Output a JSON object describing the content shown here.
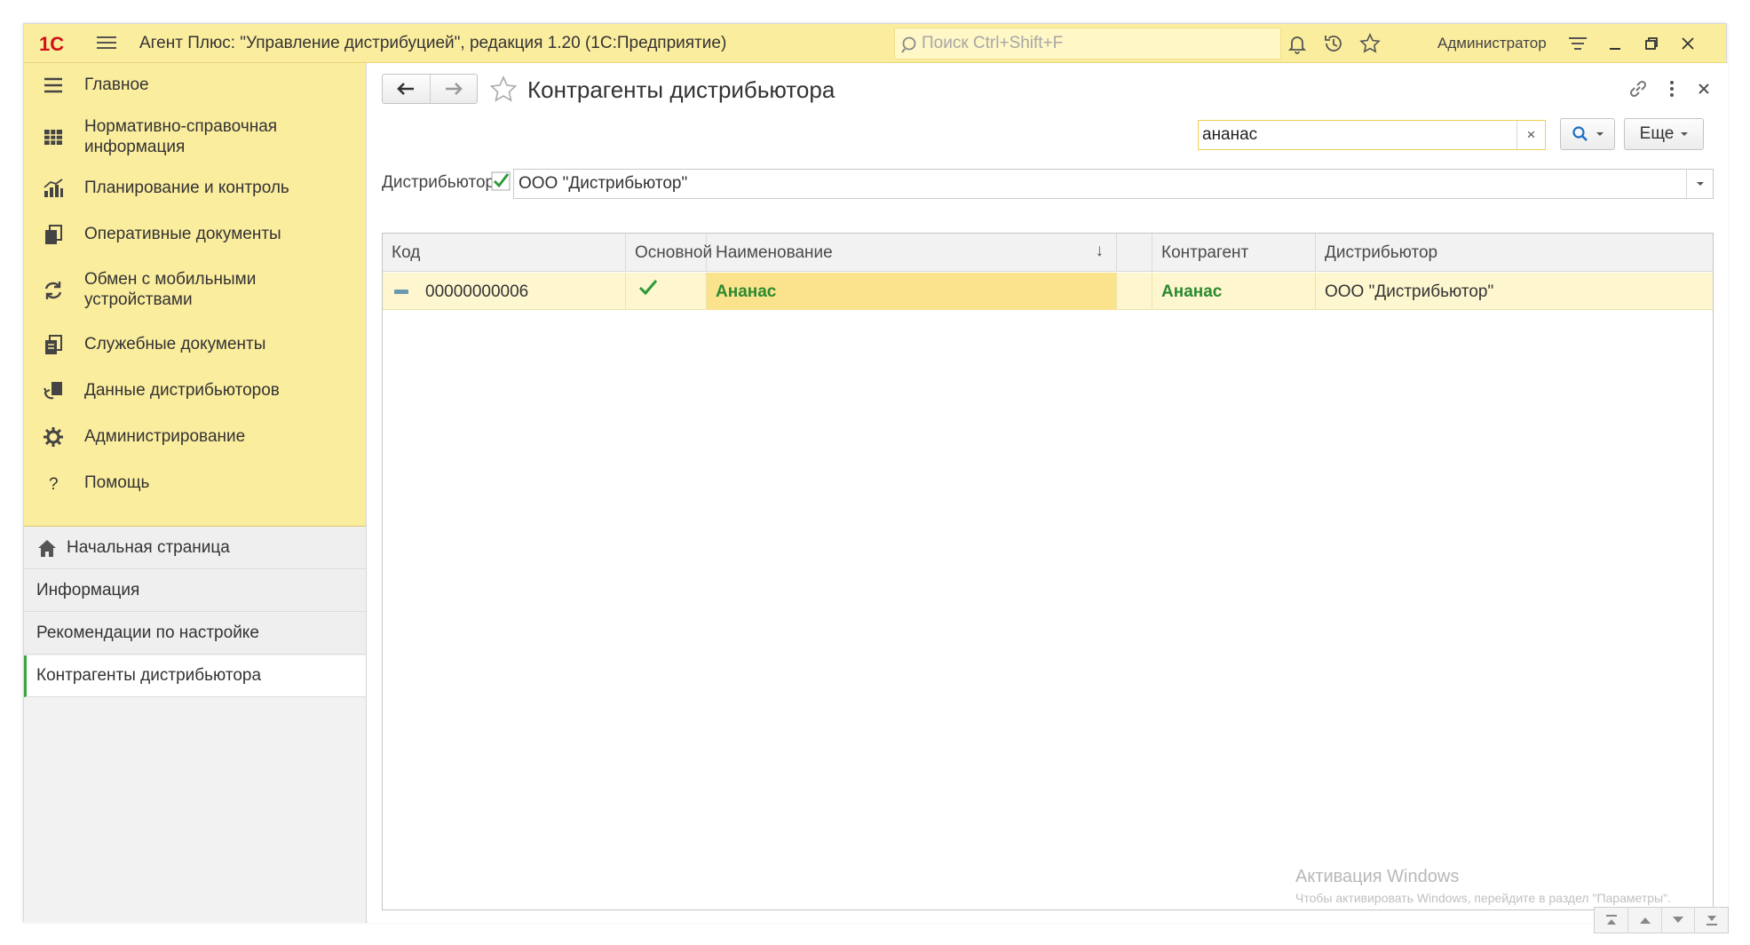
{
  "titlebar": {
    "logo_text": "1С",
    "app_title": "Агент Плюс: \"Управление дистрибуцией\", редакция 1.20  (1С:Предприятие)",
    "search_placeholder": "Поиск Ctrl+Shift+F",
    "user": "Администратор",
    "icons": [
      "bell-icon",
      "history-icon",
      "star-icon",
      "settings-icon",
      "minimize-icon",
      "restore-icon",
      "close-icon"
    ]
  },
  "sidebar": {
    "sections": [
      {
        "label": "Главное",
        "icon": "menu-icon"
      },
      {
        "label": "Нормативно-справочная информация",
        "icon": "catalog-icon"
      },
      {
        "label": "Планирование и контроль",
        "icon": "chart-icon"
      },
      {
        "label": "Оперативные документы",
        "icon": "documents-icon"
      },
      {
        "label": "Обмен с мобильными устройствами",
        "icon": "sync-icon"
      },
      {
        "label": "Служебные документы",
        "icon": "service-docs-icon"
      },
      {
        "label": "Данные дистрибьюторов",
        "icon": "distributor-data-icon"
      },
      {
        "label": "Администрирование",
        "icon": "gear-icon"
      },
      {
        "label": "Помощь",
        "icon": "help-icon"
      }
    ],
    "open_windows": [
      {
        "label": "Начальная страница",
        "icon": "home-icon"
      },
      {
        "label": "Информация"
      },
      {
        "label": "Рекомендации по настройке"
      },
      {
        "label": "Контрагенты дистрибьютора",
        "active": true
      }
    ]
  },
  "form": {
    "title": "Контрагенты дистрибьютора",
    "search_value": "ананас",
    "clear_label": "×",
    "more_label": "Еще",
    "filter_label": "Дистрибьютор:",
    "filter_checked": true,
    "filter_value": "ООО \"Дистрибьютор\""
  },
  "table": {
    "columns": [
      "Код",
      "Основной",
      "Наименование",
      "",
      "Контрагент",
      "Дистрибьютор"
    ],
    "sort_indicator": "↓",
    "rows": [
      {
        "code": "00000000006",
        "main": true,
        "name": "Ананас",
        "extra": "",
        "counterparty": "Ананас",
        "distributor": "ООО \"Дистрибьютор\""
      }
    ]
  },
  "watermark": {
    "line1": "Активация Windows",
    "line2": "Чтобы активировать Windows, перейдите в раздел \"Параметры\"."
  },
  "colors": {
    "panel_yellow": "#fbed9e",
    "selected_row": "#fdf6cf",
    "selected_cell": "#fbe38d",
    "green_text": "#2b8a2f",
    "active_marker": "#3aa63f"
  }
}
